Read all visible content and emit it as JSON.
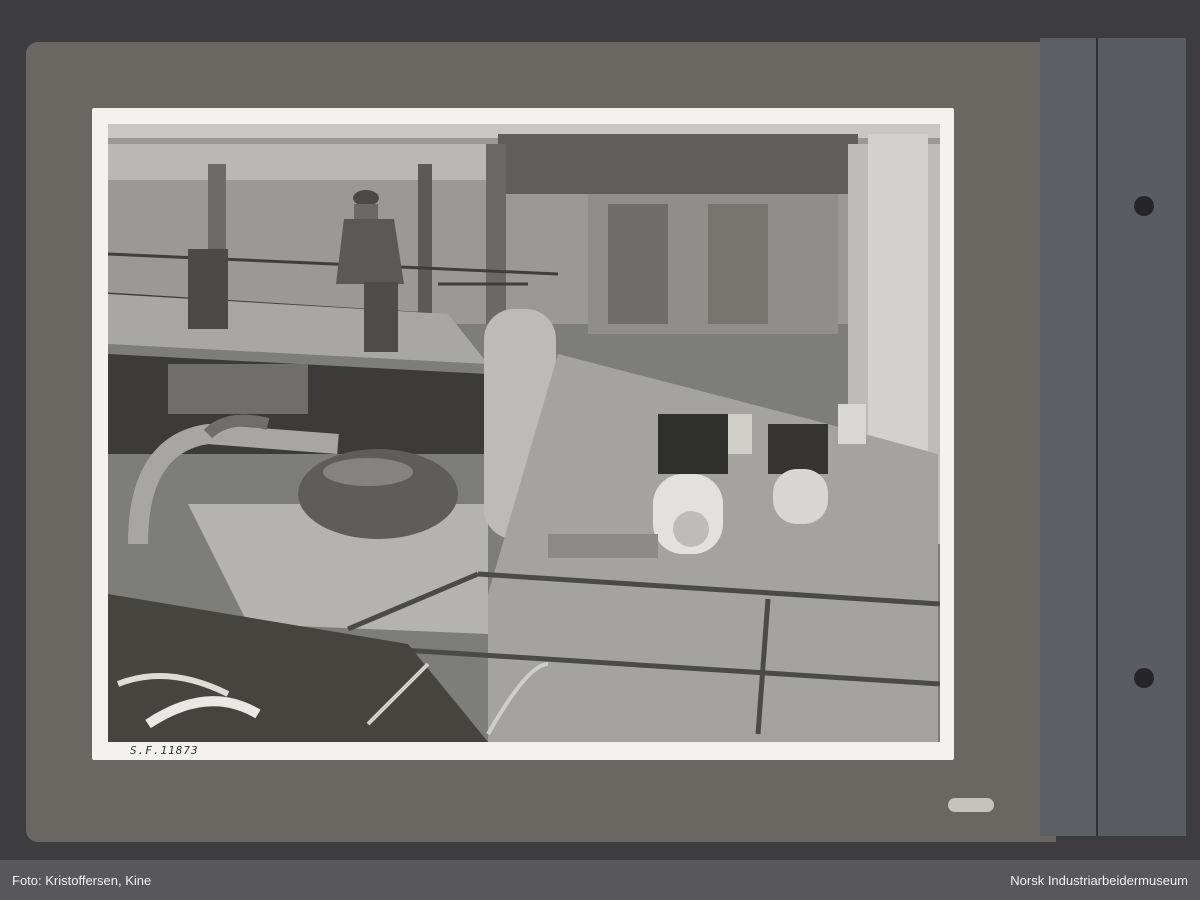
{
  "photo": {
    "catalog_number": "S.F.11873"
  },
  "caption": {
    "credit": "Foto: Kristoffersen, Kine",
    "institution": "Norsk Industriarbeidermuseum"
  }
}
